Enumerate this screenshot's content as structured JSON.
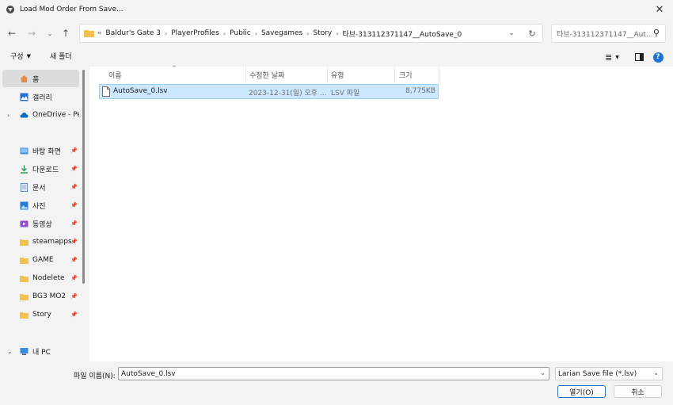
{
  "window": {
    "title": "Load Mod Order From Save..."
  },
  "address": {
    "overflow": "«",
    "crumbs": [
      "Baldur's Gate 3",
      "PlayerProfiles",
      "Public",
      "Savegames",
      "Story",
      "타브-313112371147__AutoSave_0"
    ]
  },
  "search": {
    "placeholder": "타브-313112371147__Aut..."
  },
  "commandbar": {
    "organize": "구성",
    "new_folder": "새 폴더"
  },
  "sidebar": {
    "home": "홈",
    "gallery": "갤러리",
    "onedrive": "OneDrive - Pers",
    "desktop": "바탕 화면",
    "downloads": "다운로드",
    "documents": "문서",
    "pictures": "사진",
    "videos": "동영상",
    "steamapps": "steamapps",
    "game": "GAME",
    "nodelete": "Nodelete",
    "bg3mo2": "BG3 MO2",
    "story": "Story",
    "thispc": "내 PC"
  },
  "columns": {
    "name": "이름",
    "date": "수정한 날짜",
    "type": "유형",
    "size": "크기"
  },
  "files": [
    {
      "name": "AutoSave_0.lsv",
      "date": "2023-12-31(일) 오후 ...",
      "type": "LSV 파일",
      "size": "8,775KB"
    }
  ],
  "footer": {
    "filename_label": "파일 이름(N):",
    "filename_value": "AutoSave_0.lsv",
    "filter": "Larian Save file (*.lsv)",
    "open_label": "열기(O)",
    "cancel_label": "취소"
  },
  "colors": {
    "selection": "#cce8ff",
    "selection_border": "#99d1ff",
    "folder": "#f2c14e",
    "accent": "#1a73d9"
  }
}
